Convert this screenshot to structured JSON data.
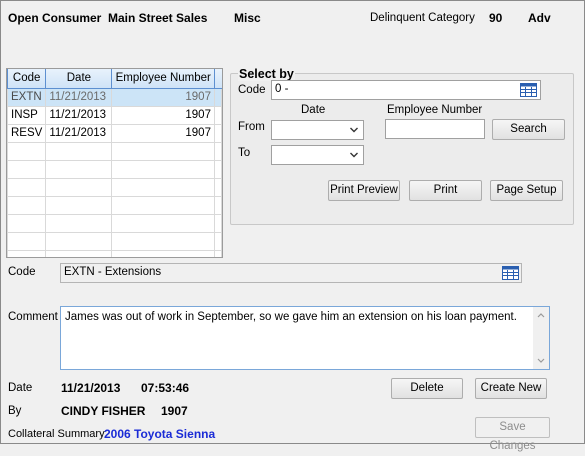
{
  "header": {
    "status": "Open Consumer",
    "dealer": "Main Street Sales",
    "type": "Misc",
    "delinquent_label": "Delinquent Category",
    "delinquent_value": "90",
    "adv": "Adv"
  },
  "grid": {
    "columns": [
      "Code",
      "Date",
      "Employee Number"
    ],
    "rows": [
      {
        "code": "EXTN",
        "date": "11/21/2013",
        "employee": "1907",
        "selected": true
      },
      {
        "code": "INSP",
        "date": "11/21/2013",
        "employee": "1907",
        "selected": false
      },
      {
        "code": "RESV",
        "date": "11/21/2013",
        "employee": "1907",
        "selected": false
      }
    ],
    "empty_rows": 6
  },
  "select_by": {
    "title": "Select by",
    "code_label": "Code",
    "code_value": "0 -",
    "date_header": "Date",
    "employee_header": "Employee Number",
    "from_label": "From",
    "to_label": "To",
    "from_value": "",
    "to_value": "",
    "employee_value": "",
    "search_button": "Search",
    "print_preview_button": "Print Preview",
    "print_button": "Print",
    "page_setup_button": "Page Setup"
  },
  "detail": {
    "code_label": "Code",
    "code_value": "EXTN - Extensions",
    "comment_label": "Comment",
    "comment_value": "James was out of work in September, so we gave him an extension on his loan payment.",
    "date_label": "Date",
    "date_value": "11/21/2013",
    "time_value": "07:53:46",
    "by_label": "By",
    "by_name": "CINDY FISHER",
    "by_number": "1907",
    "collateral_label": "Collateral Summary",
    "collateral_value": "2006 Toyota Sienna",
    "delete_button": "Delete",
    "create_button": "Create New",
    "save_button": "Save Changes"
  },
  "icons": {
    "lookup": "table-lookup-icon",
    "dropdown": "chevron-down-icon",
    "scroll_up": "scroll-up-icon",
    "scroll_down": "scroll-down-icon"
  },
  "colors": {
    "link": "#1a2bd6",
    "selected_row": "#cce4f7",
    "header_accent": "#5d8fd0"
  }
}
